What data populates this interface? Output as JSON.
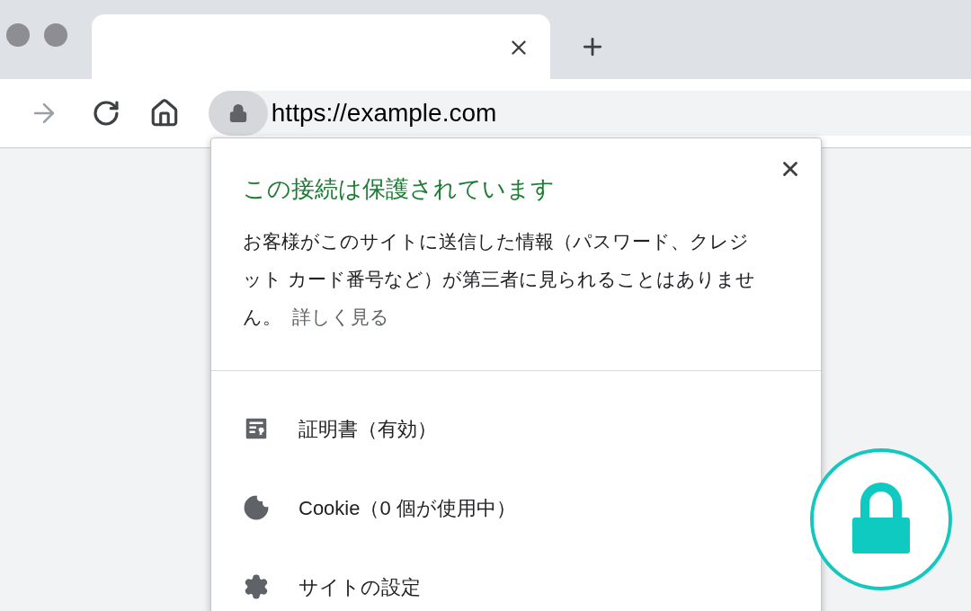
{
  "toolbar": {
    "forward_disabled": true,
    "address": "https://example.com"
  },
  "popup": {
    "title": "この接続は保護されています",
    "message": "お客様がこのサイトに送信した情報（パスワード、クレジット カード番号など）が第三者に見られることはありません。",
    "link": "詳しく見る",
    "items": [
      {
        "kind": "certificate",
        "label": "証明書（有効）"
      },
      {
        "kind": "cookie",
        "label": "Cookie（0 個が使用中）"
      },
      {
        "kind": "settings",
        "label": "サイトの設定"
      }
    ]
  }
}
